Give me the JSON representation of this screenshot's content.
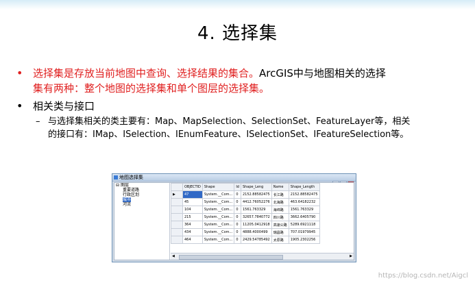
{
  "slide": {
    "title": "4. 选择集",
    "bullet1_red": "选择集是存放当前地图中查询、选择结果的集合。",
    "bullet1_black": "ArcGIS中与地图相关的选择",
    "bullet1_line2": "集有两种：整个地图的选择集和单个图层的选择集。",
    "bullet2": "相关类与接口",
    "sub1_line1": "与选择集相关的类主要有：Map、MapSelection、SelectionSet、FeatureLayer等，相关",
    "sub1_line2": "的接口有：IMap、ISelection、IEnumFeature、ISelectionSet、IFeatureSelection等。",
    "bullet_mark": "•",
    "dash_mark": "–"
  },
  "window": {
    "title": "地图选择集",
    "buttons": [
      "–",
      "□",
      "×"
    ],
    "tree": [
      {
        "label": "图层",
        "level": 0
      },
      {
        "label": "重要道路",
        "level": 1
      },
      {
        "label": "行政区划",
        "level": 1
      },
      {
        "label": "城市",
        "level": 1,
        "selected": true
      },
      {
        "label": "河流",
        "level": 1
      }
    ],
    "columns": [
      "OBJECTID",
      "Shape",
      "Id",
      "Shape_Leng",
      "Name",
      "Shape_Length"
    ],
    "rows": [
      [
        "47",
        "System.__Com...",
        "0",
        "2152.88582475",
        "长江路",
        "2152.88582475"
      ],
      [
        "45",
        "System.__Com...",
        "0",
        "4412.76052276",
        "北海路",
        "463.64182232"
      ],
      [
        "104",
        "System.__Com...",
        "0",
        "1561.763329",
        "海绵路",
        "1561.763329"
      ],
      [
        "215",
        "System.__Com...",
        "0",
        "32657.7840772",
        "四川路",
        "3662.6405790"
      ],
      [
        "364",
        "System.__Com...",
        "0",
        "11205.0412918",
        "高速公路",
        "5289.6921118"
      ],
      [
        "434",
        "System.__Com...",
        "0",
        "4888.4000499",
        "瑞昌路",
        "707.01979945"
      ],
      [
        "464",
        "System.__Com...",
        "0",
        "2429.54785492",
        "太原路",
        "1905.2302256"
      ]
    ]
  },
  "watermark": "https://blog.csdn.net/Aigcl"
}
